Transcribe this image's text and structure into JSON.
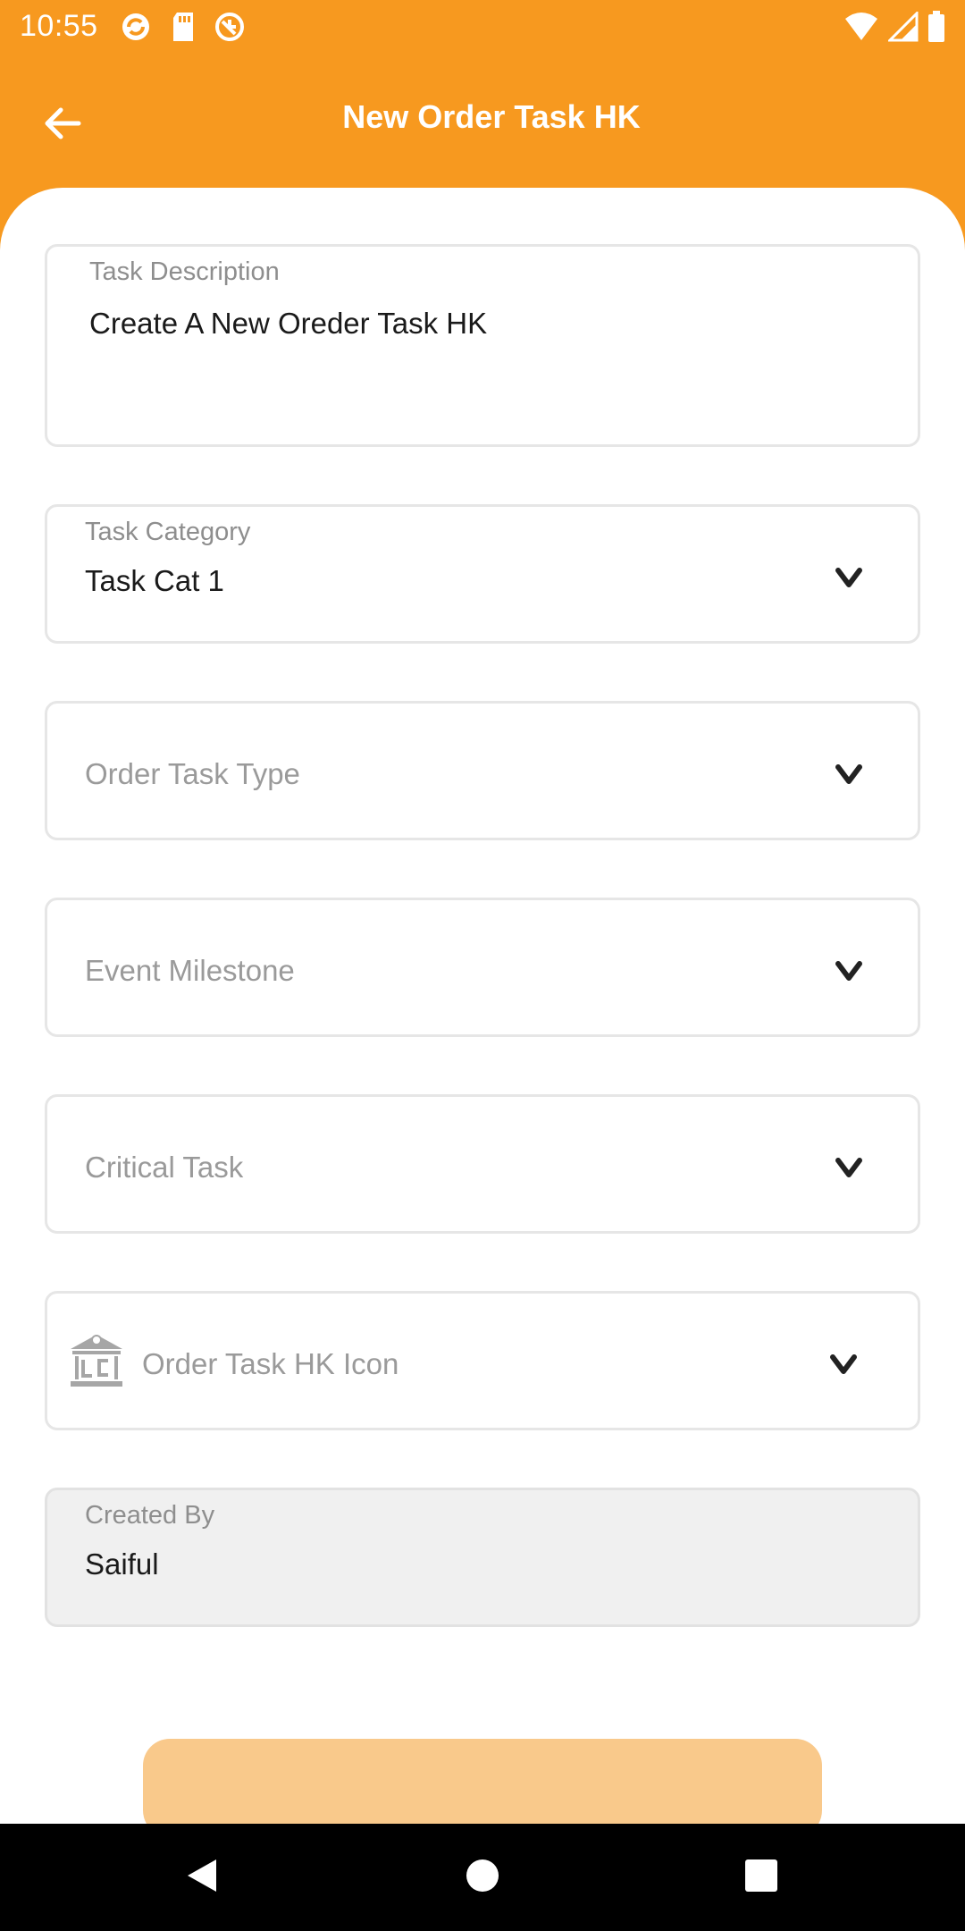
{
  "status_bar": {
    "time": "10:55",
    "left_icons": [
      "sync-icon",
      "sd-card-icon",
      "data-saver-icon"
    ],
    "right_icons": [
      "wifi-icon",
      "cellular-signal-icon",
      "battery-icon"
    ]
  },
  "app_bar": {
    "title": "New Order Task HK",
    "back_icon": "arrow-left-icon"
  },
  "form": {
    "task_description": {
      "label": "Task Description",
      "value": "Create A New Oreder Task HK"
    },
    "task_category": {
      "label": "Task Category",
      "value": "Task Cat 1"
    },
    "order_task_type": {
      "placeholder": "Order Task Type"
    },
    "event_milestone": {
      "placeholder": "Event Milestone"
    },
    "critical_task": {
      "placeholder": "Critical Task"
    },
    "order_task_hk_icon": {
      "placeholder": "Order Task HK Icon",
      "icon": "lc-bank-icon"
    },
    "created_by": {
      "label": "Created By",
      "value": "Saiful"
    }
  },
  "colors": {
    "primary": "#F7991F",
    "submit_button": "#F9C98B",
    "field_border": "#E6E6E6",
    "disabled_field_bg": "#F0F0F0"
  },
  "nav_bar": {
    "buttons": [
      "back-triangle-icon",
      "home-circle-icon",
      "recents-square-icon"
    ]
  }
}
